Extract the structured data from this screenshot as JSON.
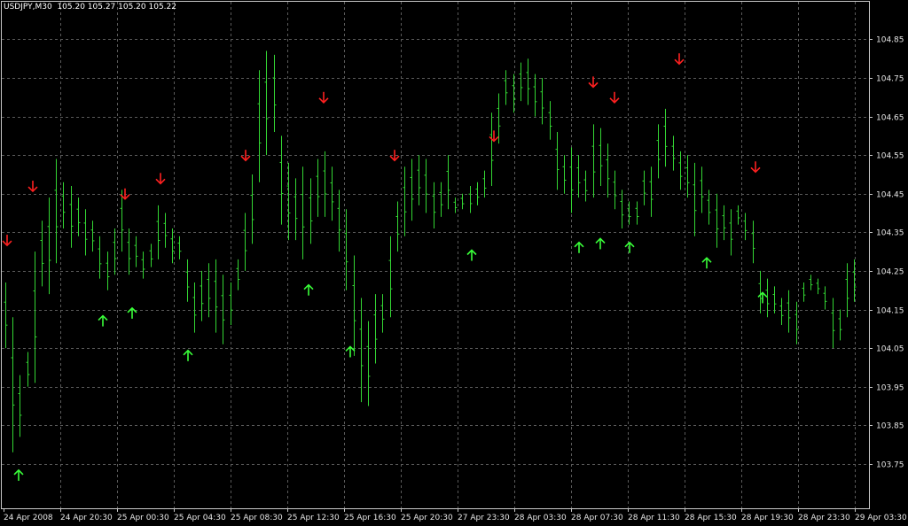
{
  "header": {
    "symbol": "USDJPY,M30",
    "quote": "105.20 105.27 105.20 105.22"
  },
  "colors": {
    "background": "#000000",
    "grid": "#5a5a5a",
    "bars": "#33d633",
    "up_arrow": "#39ff39",
    "down_arrow": "#ff2020",
    "text": "#e6e6e6"
  },
  "chart_data": {
    "type": "ohlc-bar",
    "y_range": [
      103.69,
      104.89
    ],
    "y_ticks": [
      "104.85",
      "104.75",
      "104.65",
      "104.55",
      "104.45",
      "104.35",
      "104.25",
      "104.15",
      "104.05",
      "103.95",
      "103.85",
      "103.75"
    ],
    "x_ticks": [
      "24 Apr 2008",
      "24 Apr 20:30",
      "25 Apr 00:30",
      "25 Apr 04:30",
      "25 Apr 08:30",
      "25 Apr 12:30",
      "25 Apr 16:30",
      "25 Apr 20:30",
      "27 Apr 23:30",
      "28 Apr 03:30",
      "28 Apr 07:30",
      "28 Apr 11:30",
      "28 Apr 15:30",
      "28 Apr 19:30",
      "28 Apr 23:30",
      "29 Apr 03:30"
    ],
    "grid": true,
    "bars": [
      [
        104.22,
        104.05
      ],
      [
        104.13,
        103.78
      ],
      [
        103.98,
        103.82
      ],
      [
        104.04,
        103.95
      ],
      [
        104.3,
        103.96
      ],
      [
        104.38,
        104.21
      ],
      [
        104.44,
        104.19
      ],
      [
        104.54,
        104.27
      ],
      [
        104.48,
        104.36
      ],
      [
        104.47,
        104.31
      ],
      [
        104.44,
        104.34
      ],
      [
        104.41,
        104.29
      ],
      [
        104.38,
        104.3
      ],
      [
        104.34,
        104.23
      ],
      [
        104.3,
        104.2
      ],
      [
        104.36,
        104.24
      ],
      [
        104.46,
        104.3
      ],
      [
        104.36,
        104.24
      ],
      [
        104.34,
        104.26
      ],
      [
        104.3,
        104.23
      ],
      [
        104.32,
        104.26
      ],
      [
        104.42,
        104.28
      ],
      [
        104.4,
        104.31
      ],
      [
        104.36,
        104.27
      ],
      [
        104.34,
        104.28
      ],
      [
        104.28,
        104.17
      ],
      [
        104.22,
        104.09
      ],
      [
        104.25,
        104.12
      ],
      [
        104.27,
        104.13
      ],
      [
        104.28,
        104.09
      ],
      [
        104.24,
        104.06
      ],
      [
        104.22,
        104.11
      ],
      [
        104.28,
        104.2
      ],
      [
        104.4,
        104.25
      ],
      [
        104.5,
        104.32
      ],
      [
        104.77,
        104.48
      ],
      [
        104.82,
        104.55
      ],
      [
        104.81,
        104.61
      ],
      [
        104.6,
        104.37
      ],
      [
        104.53,
        104.33
      ],
      [
        104.49,
        104.33
      ],
      [
        104.52,
        104.28
      ],
      [
        104.49,
        104.32
      ],
      [
        104.54,
        104.39
      ],
      [
        104.56,
        104.39
      ],
      [
        104.52,
        104.38
      ],
      [
        104.46,
        104.3
      ],
      [
        104.41,
        104.2
      ],
      [
        104.29,
        104.03
      ],
      [
        104.18,
        103.91
      ],
      [
        104.12,
        103.9
      ],
      [
        104.19,
        104.01
      ],
      [
        104.19,
        104.09
      ],
      [
        104.34,
        104.13
      ],
      [
        104.43,
        104.3
      ],
      [
        104.52,
        104.34
      ],
      [
        104.54,
        104.38
      ],
      [
        104.55,
        104.42
      ],
      [
        104.54,
        104.4
      ],
      [
        104.48,
        104.36
      ],
      [
        104.48,
        104.39
      ],
      [
        104.55,
        104.41
      ],
      [
        104.44,
        104.4
      ],
      [
        104.45,
        104.41
      ],
      [
        104.47,
        104.4
      ],
      [
        104.48,
        104.42
      ],
      [
        104.51,
        104.44
      ],
      [
        104.66,
        104.47
      ],
      [
        104.71,
        104.58
      ],
      [
        104.77,
        104.68
      ],
      [
        104.76,
        104.66
      ],
      [
        104.79,
        104.69
      ],
      [
        104.8,
        104.68
      ],
      [
        104.76,
        104.65
      ],
      [
        104.75,
        104.63
      ],
      [
        104.69,
        104.59
      ],
      [
        104.61,
        104.46
      ],
      [
        104.55,
        104.45
      ],
      [
        104.57,
        104.4
      ],
      [
        104.55,
        104.44
      ],
      [
        104.51,
        104.43
      ],
      [
        104.63,
        104.44
      ],
      [
        104.62,
        104.47
      ],
      [
        104.58,
        104.44
      ],
      [
        104.51,
        104.41
      ],
      [
        104.46,
        104.36
      ],
      [
        104.43,
        104.37
      ],
      [
        104.43,
        104.37
      ],
      [
        104.51,
        104.42
      ],
      [
        104.52,
        104.39
      ],
      [
        104.63,
        104.49
      ],
      [
        104.67,
        104.52
      ],
      [
        104.6,
        104.51
      ],
      [
        104.56,
        104.46
      ],
      [
        104.55,
        104.44
      ],
      [
        104.53,
        104.34
      ],
      [
        104.52,
        104.4
      ],
      [
        104.46,
        104.37
      ],
      [
        104.45,
        104.31
      ],
      [
        104.42,
        104.33
      ],
      [
        104.41,
        104.29
      ],
      [
        104.42,
        104.37
      ],
      [
        104.4,
        104.33
      ],
      [
        104.38,
        104.27
      ],
      [
        104.25,
        104.14
      ],
      [
        104.23,
        104.13
      ],
      [
        104.21,
        104.14
      ],
      [
        104.18,
        104.11
      ],
      [
        104.2,
        104.09
      ],
      [
        104.17,
        104.06
      ],
      [
        104.22,
        104.17
      ],
      [
        104.24,
        104.2
      ],
      [
        104.23,
        104.19
      ],
      [
        104.21,
        104.15
      ],
      [
        104.18,
        104.05
      ],
      [
        104.15,
        104.07
      ],
      [
        104.27,
        104.13
      ],
      [
        104.28,
        104.17
      ]
    ],
    "signals": {
      "up": [
        [
          21,
          103.72
        ],
        [
          116,
          104.12
        ],
        [
          149,
          104.14
        ],
        [
          212,
          104.03
        ],
        [
          348,
          104.2
        ],
        [
          395,
          104.04
        ],
        [
          532,
          104.29
        ],
        [
          653,
          104.31
        ],
        [
          677,
          104.32
        ],
        [
          710,
          104.31
        ],
        [
          797,
          104.27
        ],
        [
          860,
          104.18
        ]
      ],
      "down": [
        [
          8,
          104.33
        ],
        [
          37,
          104.47
        ],
        [
          141,
          104.45
        ],
        [
          181,
          104.49
        ],
        [
          277,
          104.55
        ],
        [
          365,
          104.7
        ],
        [
          445,
          104.55
        ],
        [
          557,
          104.6
        ],
        [
          669,
          104.74
        ],
        [
          693,
          104.7
        ],
        [
          766,
          104.8
        ],
        [
          852,
          104.52
        ]
      ]
    }
  }
}
